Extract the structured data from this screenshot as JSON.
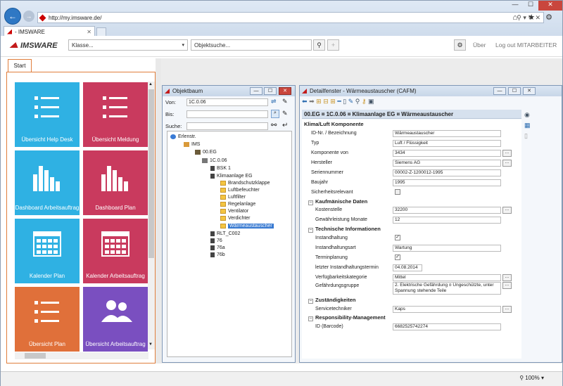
{
  "browser": {
    "url": "http://my.imsware.de/",
    "tab_title": "- IMSWARE"
  },
  "app": {
    "logo_text": "IMSWARE",
    "klasse_placeholder": "Klasse...",
    "objektsuche_placeholder": "Objektsuche...",
    "uber": "Über",
    "logout": "Log out MITARBEITER"
  },
  "start": {
    "tab": "Start",
    "tiles": [
      {
        "label": "Übersicht Help Desk",
        "color": "#2fb1e3",
        "icon": "list-icon"
      },
      {
        "label": "Übersicht Meldung",
        "color": "#c93a5e",
        "icon": "list-icon"
      },
      {
        "label": "Dashboard Arbeitsauftrag",
        "color": "#2fb1e3",
        "icon": "bar-chart-icon"
      },
      {
        "label": "Dashboard Plan",
        "color": "#c93a5e",
        "icon": "bar-chart-icon"
      },
      {
        "label": "Kalender Plan",
        "color": "#2fb1e3",
        "icon": "calendar-icon"
      },
      {
        "label": "Kalender Arbeitsauftrag",
        "color": "#c93a5e",
        "icon": "calendar-icon"
      },
      {
        "label": "Übersicht Plan",
        "color": "#e0703a",
        "icon": "list-icon"
      },
      {
        "label": "Übersicht Arbeitsauftrag",
        "color": "#7a4fc0",
        "icon": "users-icon"
      }
    ]
  },
  "objektbaum": {
    "title": "Objektbaum",
    "von_label": "Von:",
    "von_value": "1C.0.06",
    "bis_label": "Bis:",
    "bis_value": "",
    "suche_label": "Suche:",
    "suche_value": "",
    "nodes": [
      {
        "text": "Erlenstr."
      },
      {
        "text": "IMS"
      },
      {
        "text": "00.EG"
      },
      {
        "text": "1C.0.06"
      },
      {
        "text": "BSK 1"
      },
      {
        "text": "Klimaanlage EG"
      },
      {
        "text": "Brandschutzklappe"
      },
      {
        "text": "Luftbefeuchter"
      },
      {
        "text": "Luftfilter"
      },
      {
        "text": "Regelanlage"
      },
      {
        "text": "Ventilator"
      },
      {
        "text": "Verdichter"
      },
      {
        "text": "Wärmeaustauscher"
      },
      {
        "text": "RLT_C002"
      },
      {
        "text": "76"
      },
      {
        "text": "76a"
      },
      {
        "text": "76b"
      }
    ]
  },
  "detail": {
    "title": "Detailfenster - Wärmeaustauscher (CAFM)",
    "header": "00.EG ¤ 1C.0.06 ¤ Klimaanlage EG ¤ Wärmeaustauscher",
    "section_main": "Klima/Luft Komponente",
    "rows": {
      "id": {
        "label": "ID-Nr. / Bezeichnung",
        "value": "Wärmeaustauscher"
      },
      "typ": {
        "label": "Typ",
        "value": "Luft / Flüssigkeit"
      },
      "komp": {
        "label": "Komponente von",
        "value": "3434"
      },
      "herst": {
        "label": "Hersteller",
        "value": "Siemens AG"
      },
      "serie": {
        "label": "Seriennummer",
        "value": "00002-Z-1200012-1995"
      },
      "baujahr": {
        "label": "Baujahr",
        "value": "1995"
      },
      "sicher": {
        "label": "Sicherheitsrelevant"
      },
      "kosten": {
        "label": "Kostenstelle",
        "value": "32200"
      },
      "gewaehr": {
        "label": "Gewährleistung Monate",
        "value": "12"
      },
      "instand": {
        "label": "Instandhaltung"
      },
      "art": {
        "label": "Instandhaltungsart",
        "value": "Wartung"
      },
      "termin": {
        "label": "Terminplanung"
      },
      "letzter": {
        "label": "letzter Instandhaltungstermin",
        "value": "04.08.2014"
      },
      "verf": {
        "label": "Verfügbarkeitskategorie",
        "value": "Mittel"
      },
      "gef": {
        "label": "Gefährdungsgruppe",
        "value": "2. Elektrische Gefährdung ¤ Ungeschützte, unter Spannung stehende Teile"
      },
      "service": {
        "label": "Servicetechniker",
        "value": "Kaps"
      },
      "barcode": {
        "label": "ID (Barcode)",
        "value": "6682525742274"
      }
    },
    "sec_kauf": "Kaufmänische Daten",
    "sec_tech": "Technische Informationen",
    "sec_zust": "Zuständigkeiten",
    "sec_resp": "Responsibility-Management"
  },
  "status": {
    "zoom": "100%"
  }
}
